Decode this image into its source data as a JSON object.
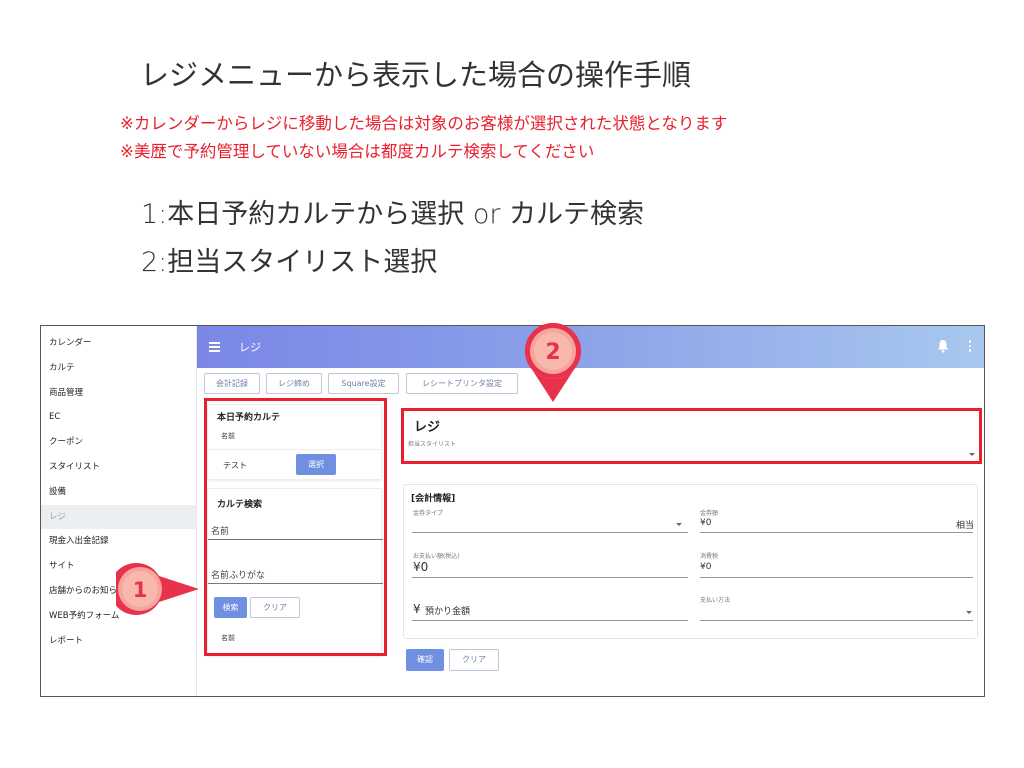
{
  "slide": {
    "title": "レジメニューから表示した場合の操作手順",
    "notes": [
      "※カレンダーからレジに移動した場合は対象のお客様が選択された状態となります",
      "※美歴で予約管理していない場合は都度カルテ検索してください"
    ],
    "steps": [
      "1:本日予約カルテから選択 or カルテ検索",
      "2:担当スタイリスト選択"
    ]
  },
  "app": {
    "sidebar": {
      "items": [
        {
          "label": "カレンダー",
          "active": false
        },
        {
          "label": "カルテ",
          "active": false
        },
        {
          "label": "商品管理",
          "active": false
        },
        {
          "label": "EC",
          "active": false
        },
        {
          "label": "クーポン",
          "active": false
        },
        {
          "label": "スタイリスト",
          "active": false
        },
        {
          "label": "設備",
          "active": false
        },
        {
          "label": "レジ",
          "active": true
        },
        {
          "label": "現金入出金記録",
          "active": false
        },
        {
          "label": "サイト",
          "active": false
        },
        {
          "label": "店舗からのお知らせ",
          "active": false
        },
        {
          "label": "WEB予約フォーム",
          "active": false
        },
        {
          "label": "レポート",
          "active": false
        }
      ]
    },
    "topbar": {
      "title": "レジ",
      "menu_icon": "menu-icon",
      "bell_icon": "bell-icon",
      "more_icon": "more-vert-icon"
    },
    "toolbar": {
      "buttons": [
        "会計記録",
        "レジ締め",
        "Square設定",
        "レシートプリンタ設定"
      ]
    },
    "today_karte": {
      "title": "本日予約カルテ",
      "column_label": "名前",
      "rows": [
        {
          "name": "テスト",
          "select_label": "選択"
        }
      ]
    },
    "karte_search": {
      "title": "カルテ検索",
      "name_placeholder": "名前",
      "kana_placeholder": "名前ふりがな",
      "search_label": "検索",
      "clear_label": "クリア",
      "result_column": "名前"
    },
    "regi": {
      "title": "レジ",
      "stylist_label": "担当スタイリスト"
    },
    "accounting": {
      "title": "[会計情報]",
      "ticket_type_label": "金券タイプ",
      "ticket_amount_label": "金券額",
      "ticket_amount_value": "¥0",
      "equivalent_label": "相当",
      "payment_label": "お支払い額(税込)",
      "payment_value": "¥0",
      "tax_label": "消費税",
      "tax_value": "¥0",
      "deposit_placeholder": "預かり金額",
      "currency_symbol": "¥",
      "method_label": "支払い方法",
      "confirm_label": "確認",
      "clear_label": "クリア"
    }
  },
  "markers": {
    "one": "1",
    "two": "2"
  },
  "colors": {
    "highlight": "#e8212f",
    "accent_blue": "#6f8fe0",
    "topbar_start": "#7b86e6",
    "topbar_end": "#a8c8ee",
    "marker_red": "#e8314a"
  }
}
